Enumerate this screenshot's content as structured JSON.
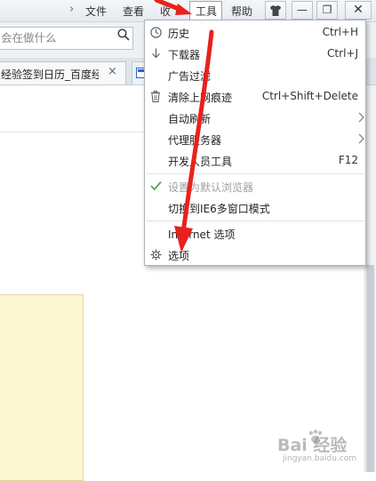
{
  "menubar": {
    "items": [
      {
        "label": "文件"
      },
      {
        "label": "查看"
      },
      {
        "label": "收"
      },
      {
        "label": "工具"
      },
      {
        "label": "帮助"
      }
    ],
    "window_buttons": {
      "skin": "shirt-icon",
      "minimize": "—",
      "maximize": "❐",
      "close": "✕"
    }
  },
  "addressbar": {
    "search_value": "会在做什么"
  },
  "tabbar": {
    "active_tab_title": "经验签到日历_百度经",
    "close_glyph": "×"
  },
  "dropdown": {
    "items": [
      {
        "label": "历史",
        "shortcut": "Ctrl+H",
        "icon": "clock-icon"
      },
      {
        "label": "下载器",
        "shortcut": "Ctrl+J",
        "icon": "download-arrow-icon"
      },
      {
        "label": "广告过滤",
        "shortcut": ""
      },
      {
        "label": "清除上网痕迹",
        "shortcut": "Ctrl+Shift+Delete",
        "icon": "trash-icon"
      },
      {
        "label": "自动刷新",
        "shortcut": "",
        "submenu": true
      },
      {
        "label": "代理服务器",
        "shortcut": "",
        "submenu": true
      },
      {
        "label": "开发人员工具",
        "shortcut": "F12"
      },
      {
        "label": "设置为默认浏览器",
        "shortcut": "",
        "disabled": true,
        "icon": "checkmark-icon"
      },
      {
        "label": "切换到IE6多窗口模式",
        "shortcut": ""
      },
      {
        "label": "Internet 选项",
        "shortcut": ""
      },
      {
        "label": "选项",
        "shortcut": "",
        "icon": "gear-icon"
      }
    ]
  },
  "watermark": {
    "text": "Bai 经验",
    "subtext": "jingyan.baidu.com"
  },
  "colors": {
    "annotation_arrow": "#e8211d",
    "check_green": "#4caf50",
    "menu_border": "#a9b2bc"
  }
}
